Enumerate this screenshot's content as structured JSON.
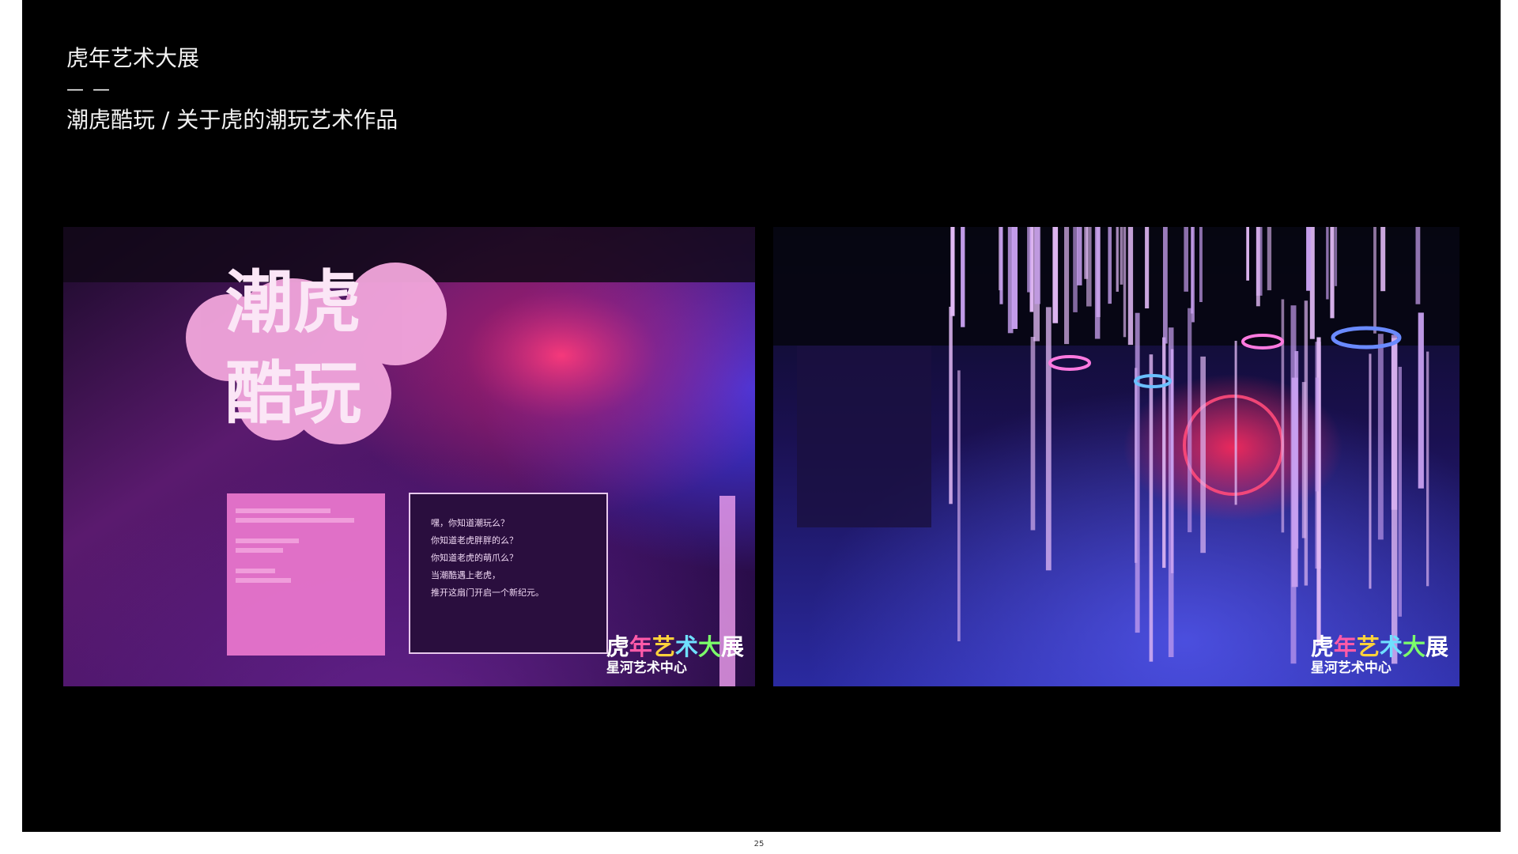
{
  "header": {
    "title": "虎年艺术大展",
    "divider": "— —",
    "subtitle": "潮虎酷玩 / 关于虎的潮玩艺术作品"
  },
  "left_photo": {
    "sign_line1": "潮虎",
    "sign_line2": "酷玩",
    "panel_lines": [
      "嘿，你知道潮玩么？",
      "你知道老虎胖胖的么？",
      "你知道老虎的萌爪么？",
      "当潮酷遇上老虎，",
      "推开这扇门开启一个新纪元。"
    ]
  },
  "watermark": {
    "chars": [
      "虎",
      "年",
      "艺",
      "术",
      "大",
      "展"
    ],
    "char_colors": [
      "#ffffff",
      "#ff5aa8",
      "#ffd23a",
      "#6fe0ff",
      "#7cff6a",
      "#ffffff"
    ],
    "line2": "星河艺术中心"
  },
  "page_number": "25"
}
